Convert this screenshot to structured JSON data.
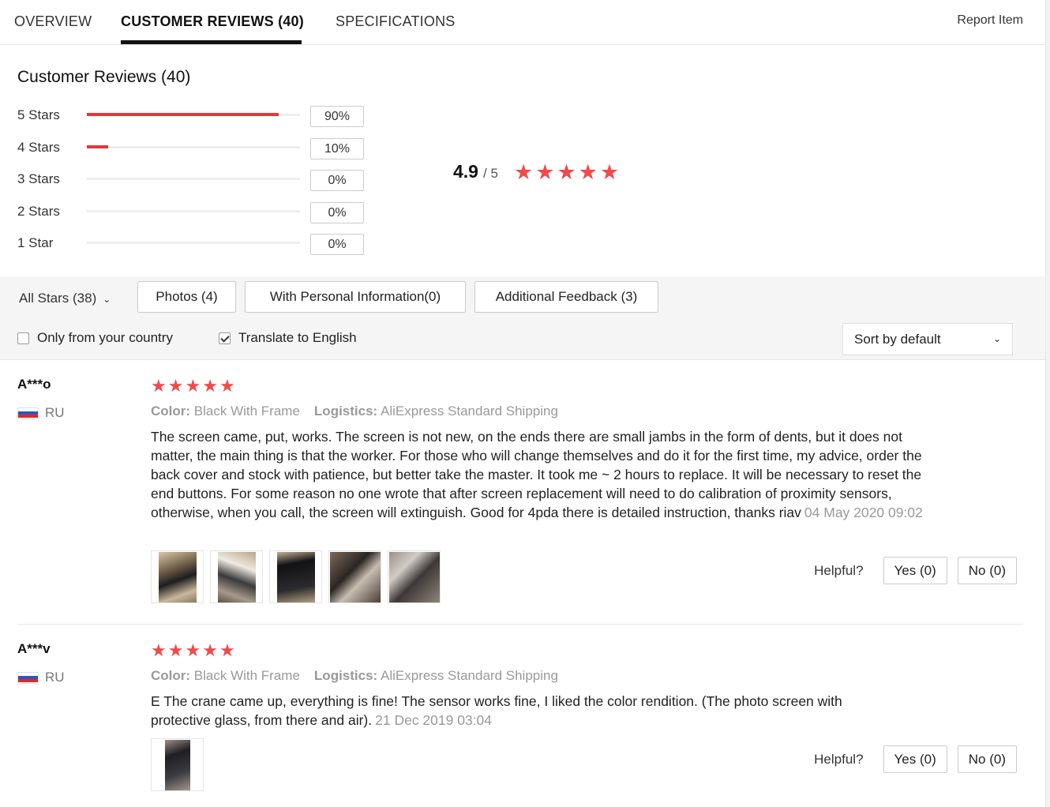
{
  "tabs": [
    {
      "label": "OVERVIEW"
    },
    {
      "label": "CUSTOMER REVIEWS (40)"
    },
    {
      "label": "SPECIFICATIONS"
    }
  ],
  "report_item": "Report Item",
  "summary": {
    "title": "Customer Reviews (40)",
    "rows": [
      {
        "label": "5 Stars",
        "pct": "90%",
        "fill": 0.9
      },
      {
        "label": "4 Stars",
        "pct": "10%",
        "fill": 0.1
      },
      {
        "label": "3 Stars",
        "pct": "0%",
        "fill": 0
      },
      {
        "label": "2 Stars",
        "pct": "0%",
        "fill": 0
      },
      {
        "label": "1 Star",
        "pct": "0%",
        "fill": 0
      }
    ],
    "average": "4.9",
    "out_of": "/ 5",
    "avg_star_count": 5
  },
  "filters": {
    "all_stars": "All Stars (38)",
    "buttons": [
      "Photos (4)",
      "With Personal Information(0)",
      "Additional Feedback (3)"
    ],
    "only_country": "Only from your country",
    "only_country_checked": false,
    "translate": "Translate to English",
    "translate_checked": true,
    "sort": "Sort by default"
  },
  "colors": {
    "accent_red": "#e6353b",
    "star_red": "#f04a4a"
  },
  "reviews": [
    {
      "name": "A***o",
      "country": "RU",
      "stars": 5,
      "color_label": "Color:",
      "color_value": "Black With Frame",
      "logistics_label": "Logistics:",
      "logistics_value": "AliExpress Standard Shipping",
      "text": "The screen came, put, works. The screen is not new, on the ends there are small jambs in the form of dents, but it does not matter, the main thing is that the worker. For those who will change themselves and do it for the first time, my advice, order the back cover and stock with patience, but better take the master. It took me ~ 2 hours to replace. It will be necessary to reset the end buttons. For some reason no one wrote that after screen replacement will need to do calibration of proximity sensors, otherwise, when you call, the screen will extinguish. Good for 4pda there is detailed instruction, thanks riav",
      "date": "04 May 2020 09:02",
      "photo_count": 5,
      "helpful": "Helpful?",
      "yes": "Yes (0)",
      "no": "No (0)"
    },
    {
      "name": "A***v",
      "country": "RU",
      "stars": 5,
      "color_label": "Color:",
      "color_value": "Black With Frame",
      "logistics_label": "Logistics:",
      "logistics_value": "AliExpress Standard Shipping",
      "text": "E The crane came up, everything is fine! The sensor works fine, I liked the color rendition. (The photo screen with protective glass, from there and air).",
      "date": "21 Dec 2019 03:04",
      "photo_count": 1,
      "helpful": "Helpful?",
      "yes": "Yes (0)",
      "no": "No (0)"
    }
  ]
}
